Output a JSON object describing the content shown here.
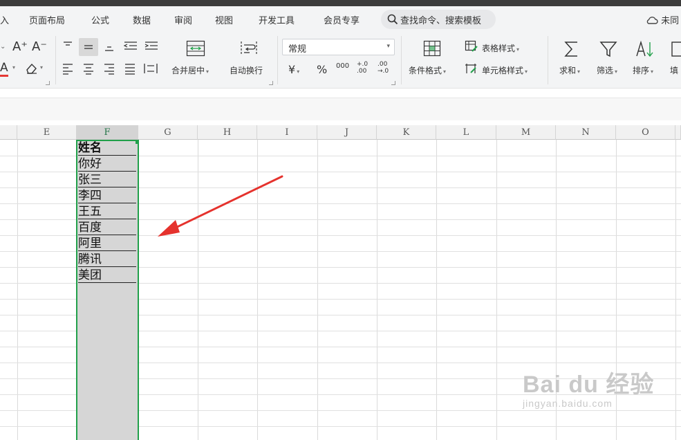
{
  "menu": {
    "items": [
      "入",
      "页面布局",
      "公式",
      "数据",
      "审阅",
      "视图",
      "开发工具",
      "会员专享"
    ],
    "search_text": "查找命令、搜索模板",
    "cloud_text": "未同"
  },
  "ribbon": {
    "font_increase": "A⁺",
    "font_decrease": "A⁻",
    "merge_center": "合并居中",
    "wrap_text": "自动换行",
    "number_format": "常规",
    "currency": "¥",
    "percent": "%",
    "thousands": "000",
    "dec_increase": "+.0 .00",
    "dec_decrease": ".00 →.0",
    "table_style": "表格样式",
    "cond_format": "条件格式",
    "cell_style": "单元格样式",
    "sum": "求和",
    "filter": "筛选",
    "sort": "排序",
    "fill": "填"
  },
  "columns": [
    "E",
    "F",
    "G",
    "H",
    "I",
    "J",
    "K",
    "L",
    "M",
    "N",
    "O"
  ],
  "selected_column": "F",
  "cells": [
    "姓名",
    "你好",
    "张三",
    "李四",
    "王五",
    "百度",
    "阿里",
    "腾讯",
    "美团"
  ],
  "watermark": {
    "line1": "Bai du 经验",
    "line2": "jingyan.baidu.com"
  },
  "colors": {
    "selection": "#21a04a",
    "arrow": "#e5322d"
  }
}
